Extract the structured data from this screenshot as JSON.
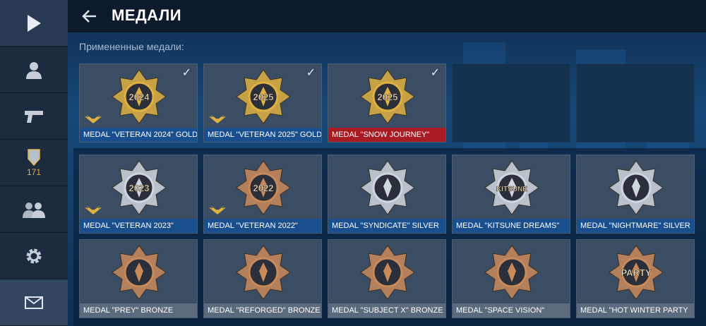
{
  "header": {
    "title": "МЕДАЛИ"
  },
  "applied_label": "Примененные медали:",
  "sidebar": {
    "badge_count": "171"
  },
  "applied": [
    {
      "label": "MEDAL \"VETERAN 2024\" GOLD",
      "caption_color": "blue",
      "checked": true,
      "icon": "veteran-2024-gold-icon",
      "tone": "gold",
      "text": "2024",
      "wings": true
    },
    {
      "label": "MEDAL \"VETERAN 2025\" GOLD",
      "caption_color": "blue",
      "checked": true,
      "icon": "veteran-2025-gold-icon",
      "tone": "gold",
      "text": "2025",
      "wings": true
    },
    {
      "label": "MEDAL \"SNOW JOURNEY\"",
      "caption_color": "red",
      "checked": true,
      "icon": "snow-journey-icon",
      "tone": "gold",
      "text": "2025",
      "wings": false
    },
    {
      "label": "",
      "empty": true
    },
    {
      "label": "",
      "empty": true
    }
  ],
  "medals": [
    {
      "label": "MEDAL \"VETERAN 2023\"",
      "caption_color": "blue",
      "icon": "veteran-2023-icon",
      "tone": "silver",
      "text": "2023",
      "wings": true
    },
    {
      "label": "MEDAL \"VETERAN 2022\"",
      "caption_color": "blue",
      "icon": "veteran-2022-icon",
      "tone": "bronze",
      "text": "2022",
      "wings": true
    },
    {
      "label": "MEDAL \"SYNDICATE\" SILVER",
      "caption_color": "blue",
      "icon": "syndicate-silver-icon",
      "tone": "silver",
      "text": "",
      "wings": false
    },
    {
      "label": "MEDAL \"KITSUNE DREAMS\"",
      "caption_color": "blue",
      "icon": "kitsune-dreams-icon",
      "tone": "silver",
      "text": "KITSUNE",
      "wings": false
    },
    {
      "label": "MEDAL \"NIGHTMARE\" SILVER",
      "caption_color": "blue",
      "icon": "nightmare-silver-icon",
      "tone": "silver",
      "text": "",
      "wings": false
    },
    {
      "label": "MEDAL \"PREY\" BRONZE",
      "caption_color": "gray",
      "icon": "prey-bronze-icon",
      "tone": "bronze",
      "text": "",
      "wings": false
    },
    {
      "label": "MEDAL \"REFORGED\" BRONZE",
      "caption_color": "gray",
      "icon": "reforged-bronze-icon",
      "tone": "bronze",
      "text": "",
      "wings": false
    },
    {
      "label": "MEDAL \"SUBJECT X\" BRONZE",
      "caption_color": "gray",
      "icon": "subject-x-bronze-icon",
      "tone": "bronze",
      "text": "",
      "wings": false
    },
    {
      "label": "MEDAL \"SPACE VISION\"",
      "caption_color": "gray",
      "icon": "space-vision-icon",
      "tone": "bronze",
      "text": "",
      "wings": false
    },
    {
      "label": "MEDAL \"HOT WINTER PARTY",
      "caption_color": "gray",
      "icon": "hot-winter-party-icon",
      "tone": "bronze",
      "text": "PARTY",
      "wings": false
    }
  ],
  "colors": {
    "gold": "#e0b040",
    "silver": "#cfd6de",
    "bronze": "#c98a5a",
    "caption_blue": "#1a4f8e",
    "caption_red": "#a81b23",
    "caption_gray": "#5b6a7c"
  }
}
